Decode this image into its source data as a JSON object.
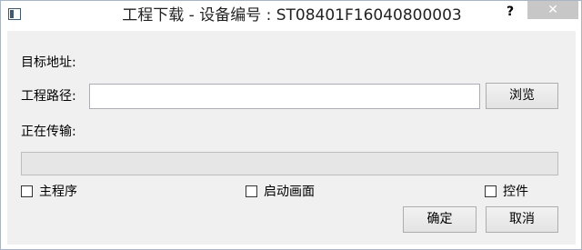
{
  "window": {
    "title": "工程下载 - 设备编号 : ST08401F16040800003",
    "help_label": "?",
    "close_label": "✕"
  },
  "form": {
    "target_address_label": "目标地址:",
    "project_path_label": "工程路径:",
    "project_path_value": "",
    "browse_label": "浏览",
    "transferring_label": "正在传输:",
    "progress_fraction": 0
  },
  "checkboxes": [
    {
      "label": "主程序",
      "checked": false
    },
    {
      "label": "启动画面",
      "checked": false
    },
    {
      "label": "控件",
      "checked": false
    }
  ],
  "buttons": {
    "ok_label": "确定",
    "cancel_label": "取消"
  }
}
